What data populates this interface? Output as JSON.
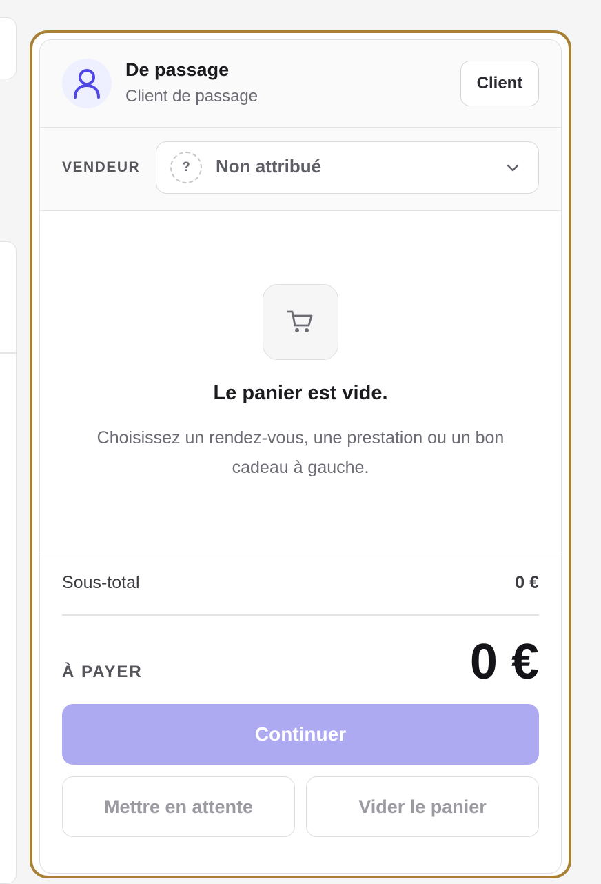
{
  "customer": {
    "name": "De passage",
    "subtitle": "Client de passage",
    "client_button": "Client"
  },
  "vendor": {
    "label": "VENDEUR",
    "placeholder_glyph": "?",
    "value": "Non attribué"
  },
  "cart": {
    "empty_title": "Le panier est vide.",
    "empty_text": "Choisissez un rendez-vous, une prestation ou un bon cadeau à gauche."
  },
  "totals": {
    "subtotal_label": "Sous-total",
    "subtotal_value": "0 €",
    "pay_label": "À PAYER",
    "pay_value": "0 €"
  },
  "actions": {
    "continue": "Continuer",
    "hold": "Mettre en attente",
    "clear": "Vider le panier"
  },
  "colors": {
    "frame": "#a88135",
    "accent": "#4f46e5",
    "continue_disabled": "#aeaaf1"
  },
  "icons": {
    "avatar": "user-icon",
    "vendor_placeholder": "question-icon",
    "dropdown": "chevron-down-icon",
    "cart": "cart-icon"
  }
}
